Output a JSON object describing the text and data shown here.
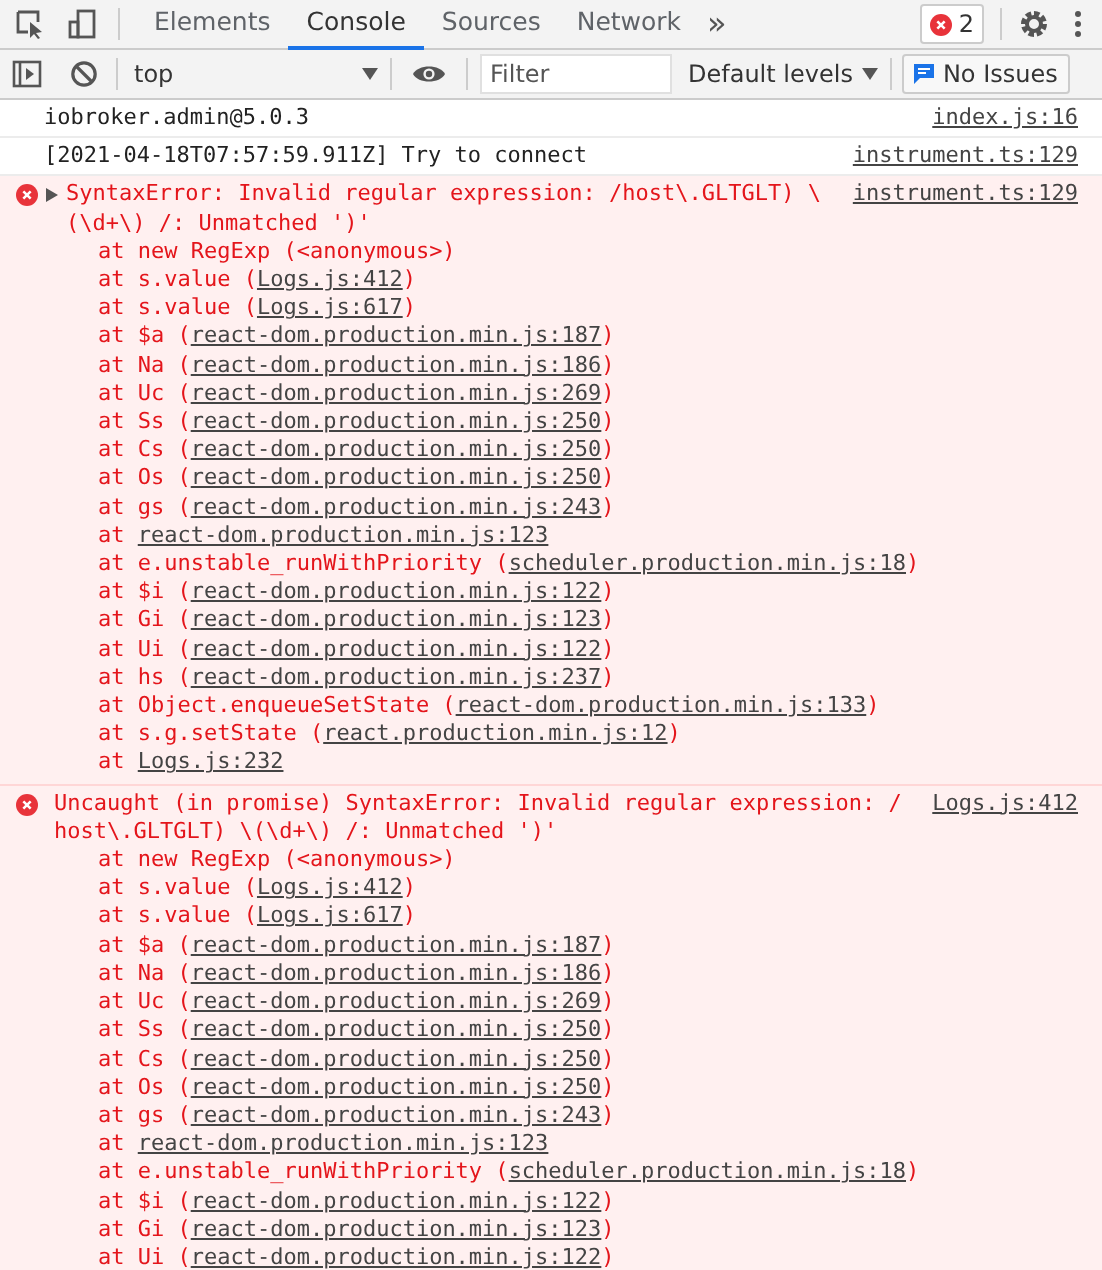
{
  "tabs": [
    {
      "label": "Elements",
      "selected": false
    },
    {
      "label": "Console",
      "selected": true
    },
    {
      "label": "Sources",
      "selected": false
    },
    {
      "label": "Network",
      "selected": false
    }
  ],
  "more_tabs": "»",
  "error_count": "2",
  "console_toolbar": {
    "context": "top",
    "filter_placeholder": "Filter",
    "levels": "Default levels",
    "issues": "No Issues"
  },
  "messages": [
    {
      "kind": "log",
      "text": "iobroker.admin@5.0.3",
      "source": "index.js:16"
    },
    {
      "kind": "log",
      "text": "[2021-04-18T07:57:59.911Z] Try to connect",
      "source": "instrument.ts:129"
    },
    {
      "kind": "error",
      "expandable": true,
      "text": "SyntaxError: Invalid regular expression: /host\\.GLTGLT) \\ (\\d+\\) /: Unmatched ')'",
      "source": "instrument.ts:129",
      "stack": [
        {
          "text": "at new RegExp (<anonymous>)"
        },
        {
          "text": "at s.value (",
          "link": "Logs.js:412",
          "end": ")"
        },
        {
          "text": "at s.value (",
          "link": "Logs.js:617",
          "end": ")"
        },
        {
          "text": "at $a (",
          "link": "react-dom.production.min.js:187",
          "end": ")"
        },
        {
          "text": "at Na (",
          "link": "react-dom.production.min.js:186",
          "end": ")"
        },
        {
          "text": "at Uc (",
          "link": "react-dom.production.min.js:269",
          "end": ")"
        },
        {
          "text": "at Ss (",
          "link": "react-dom.production.min.js:250",
          "end": ")"
        },
        {
          "text": "at Cs (",
          "link": "react-dom.production.min.js:250",
          "end": ")"
        },
        {
          "text": "at Os (",
          "link": "react-dom.production.min.js:250",
          "end": ")"
        },
        {
          "text": "at gs (",
          "link": "react-dom.production.min.js:243",
          "end": ")"
        },
        {
          "text": "at ",
          "link": "react-dom.production.min.js:123"
        },
        {
          "text": "at e.unstable_runWithPriority (",
          "link": "scheduler.production.min.js:18",
          "end": ")"
        },
        {
          "text": "at $i (",
          "link": "react-dom.production.min.js:122",
          "end": ")"
        },
        {
          "text": "at Gi (",
          "link": "react-dom.production.min.js:123",
          "end": ")"
        },
        {
          "text": "at Ui (",
          "link": "react-dom.production.min.js:122",
          "end": ")"
        },
        {
          "text": "at hs (",
          "link": "react-dom.production.min.js:237",
          "end": ")"
        },
        {
          "text": "at Object.enqueueSetState (",
          "link": "react-dom.production.min.js:133",
          "end": ")"
        },
        {
          "text": "at s.g.setState (",
          "link": "react.production.min.js:12",
          "end": ")"
        },
        {
          "text": "at ",
          "link": "Logs.js:232"
        }
      ]
    },
    {
      "kind": "error",
      "expandable": false,
      "text": "Uncaught (in promise) SyntaxError: Invalid regular expression: /host\\.GLTGLT) \\(\\d+\\) /: Unmatched ')'",
      "source": "Logs.js:412",
      "stack": [
        {
          "text": "at new RegExp (<anonymous>)"
        },
        {
          "text": "at s.value (",
          "link": "Logs.js:412",
          "end": ")"
        },
        {
          "text": "at s.value (",
          "link": "Logs.js:617",
          "end": ")"
        },
        {
          "text": "at $a (",
          "link": "react-dom.production.min.js:187",
          "end": ")"
        },
        {
          "text": "at Na (",
          "link": "react-dom.production.min.js:186",
          "end": ")"
        },
        {
          "text": "at Uc (",
          "link": "react-dom.production.min.js:269",
          "end": ")"
        },
        {
          "text": "at Ss (",
          "link": "react-dom.production.min.js:250",
          "end": ")"
        },
        {
          "text": "at Cs (",
          "link": "react-dom.production.min.js:250",
          "end": ")"
        },
        {
          "text": "at Os (",
          "link": "react-dom.production.min.js:250",
          "end": ")"
        },
        {
          "text": "at gs (",
          "link": "react-dom.production.min.js:243",
          "end": ")"
        },
        {
          "text": "at ",
          "link": "react-dom.production.min.js:123"
        },
        {
          "text": "at e.unstable_runWithPriority (",
          "link": "scheduler.production.min.js:18",
          "end": ")"
        },
        {
          "text": "at $i (",
          "link": "react-dom.production.min.js:122",
          "end": ")"
        },
        {
          "text": "at Gi (",
          "link": "react-dom.production.min.js:123",
          "end": ")"
        },
        {
          "text": "at Ui (",
          "link": "react-dom.production.min.js:122",
          "end": ")"
        }
      ]
    }
  ]
}
